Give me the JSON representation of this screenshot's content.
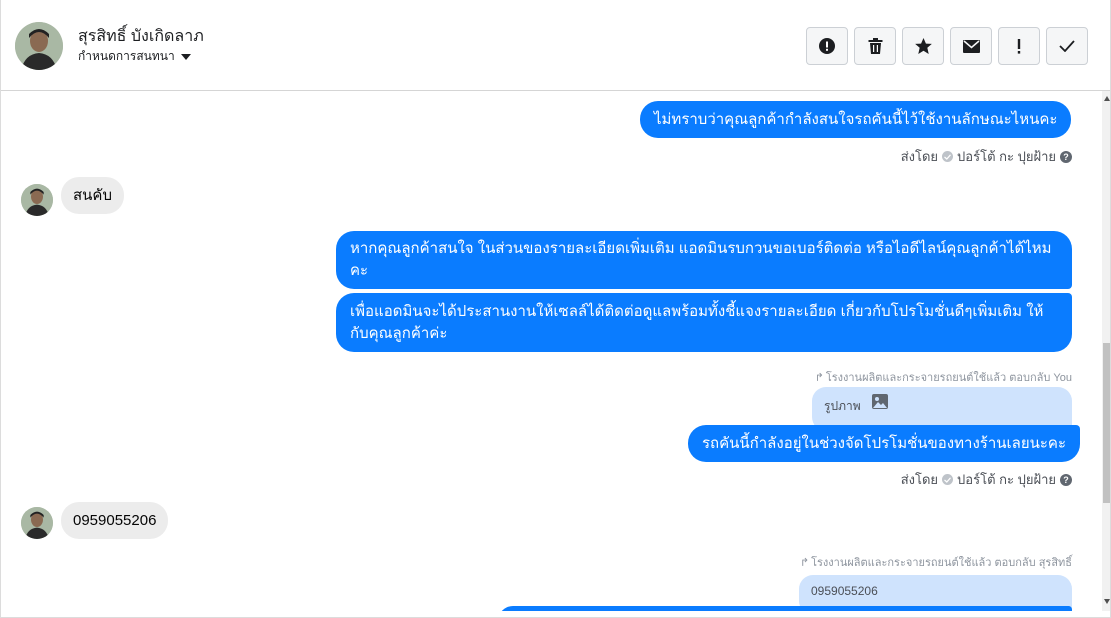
{
  "header": {
    "user_name": "สุรสิทธิ์ บังเกิดลาภ",
    "subtitle": "กำหนดการสนทนา",
    "avatar_icon": "profile-photo",
    "actions": [
      {
        "name": "report-spam-icon"
      },
      {
        "name": "trash-icon"
      },
      {
        "name": "star-icon"
      },
      {
        "name": "envelope-icon"
      },
      {
        "name": "exclamation-icon"
      },
      {
        "name": "checkmark-icon"
      }
    ]
  },
  "messages": {
    "out_1": "ไม่ทราบว่าคุณลูกค้ากำลังสนใจรถคันนี้ไว้ใช้งานลักษณะไหนคะ",
    "meta_1": {
      "sent_by": "ส่งโดย",
      "agent": "ปอร์โต้ กะ ปุยฝ้าย"
    },
    "in_1": "สนคับ",
    "out_2": "หากคุณลูกค้าสนใจ ในส่วนของรายละเอียดเพิ่มเติม แอดมินรบกวนขอเบอร์ติดต่อ หรือไอดีไลน์คุณลูกค้าได้ไหมคะ",
    "out_3": "เพื่อแอดมินจะได้ประสานงานให้เซลล์ได้ติดต่อดูแลพร้อมทั้งชี้แจงรายละเอียด เกี่ยวกับโปรโมชั่นดีๆเพิ่มเติม ให้กับคุณลูกค้าค่ะ",
    "reply_note_1": "โรงงานผลิตและกระจายรถยนต์ใช้แล้ว ตอบกลับ You",
    "quoted_1": "รูปภาพ",
    "out_4": "รถคันนี้กำลังอยู่ในช่วงจัดโปรโมชั่นของทางร้านเลยนะคะ",
    "meta_2": {
      "sent_by": "ส่งโดย",
      "agent": "ปอร์โต้ กะ ปุยฝ้าย"
    },
    "in_2": "0959055206",
    "reply_note_2": "โรงงานผลิตและกระจายรถยนต์ใช้แล้ว ตอบกลับ สุรสิทธิ์",
    "quoted_2": "0959055206"
  },
  "colors": {
    "outgoing_bubble": "#0a7cff",
    "incoming_bubble": "#ececec",
    "quoted_bubble": "#cfe3fd"
  }
}
